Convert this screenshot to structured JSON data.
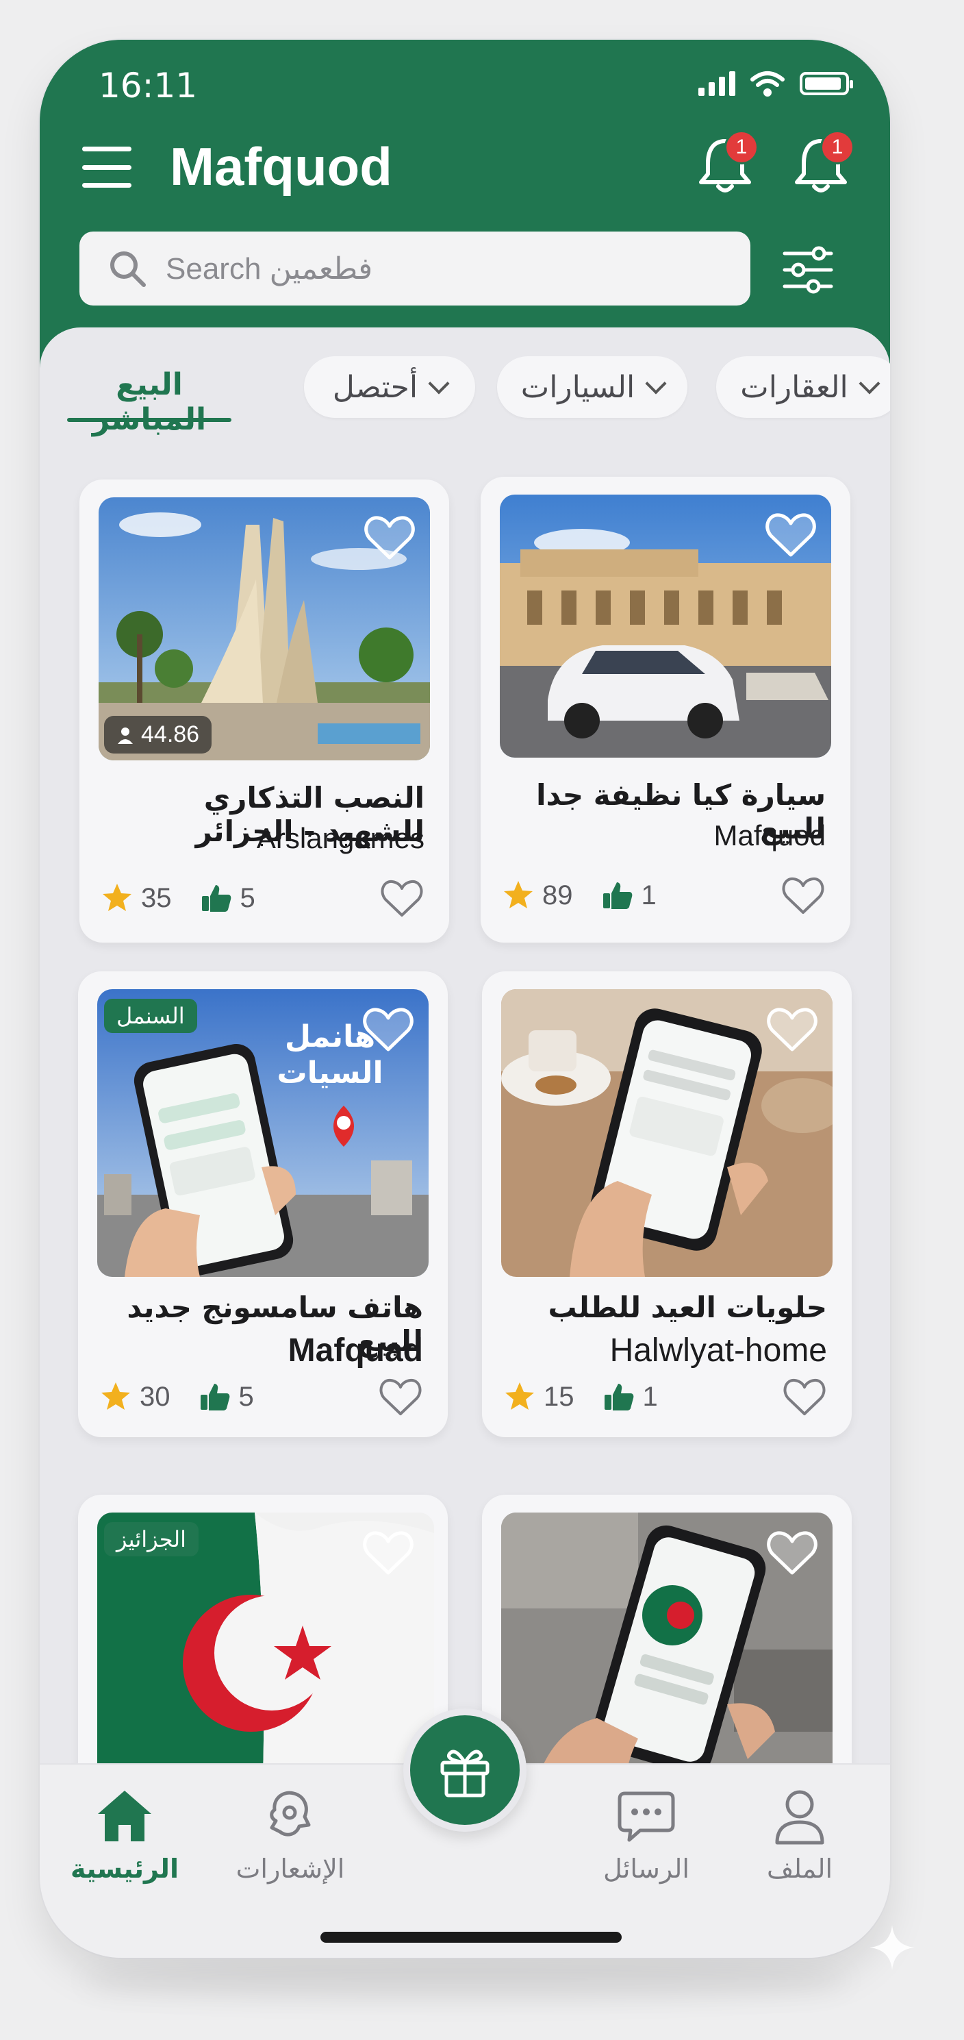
{
  "colors": {
    "brand": "#207650",
    "badge": "#e23b3b",
    "star": "#f2b01e"
  },
  "status": {
    "time": "16:11"
  },
  "header": {
    "title": "Mafquod",
    "notifications": [
      {
        "count": "1"
      },
      {
        "count": "1"
      }
    ]
  },
  "search": {
    "placeholder": "Search فطعمين",
    "icon": "search-icon"
  },
  "tabs": {
    "active": "البيع المباشر",
    "chips": [
      "أحتصل",
      "السيارات",
      "العقارات"
    ]
  },
  "cards": [
    {
      "title": "النصب التذكاري للشهيد - الجزائر",
      "seller": "Arslangames",
      "rating": "35",
      "likes": "5",
      "views": "44.86",
      "tag": ""
    },
    {
      "title": "سيارة كيا نظيفة جدا للبيع",
      "seller": "Mafquod",
      "rating": "89",
      "likes": "1",
      "views": "",
      "tag": ""
    },
    {
      "title": "هاتف سامسونج جديد للبيع",
      "seller": "Mafquad",
      "rating": "30",
      "likes": "5",
      "views": "",
      "tag": "السنمل",
      "overlay": "هانمل السيات"
    },
    {
      "title": "حلويات العيد للطلب",
      "seller": "Halwlyat-home",
      "rating": "15",
      "likes": "1",
      "views": "",
      "tag": ""
    },
    {
      "title": "",
      "seller": "",
      "rating": "",
      "likes": "",
      "views": "",
      "tag": "الجزائيز"
    },
    {
      "title": "",
      "seller": "",
      "rating": "",
      "likes": "",
      "views": "",
      "tag": ""
    }
  ],
  "bottom_nav": {
    "home": "الرئيسية",
    "notifications": "الإشعارات",
    "messages": "الرسائل",
    "profile": "الملف"
  }
}
